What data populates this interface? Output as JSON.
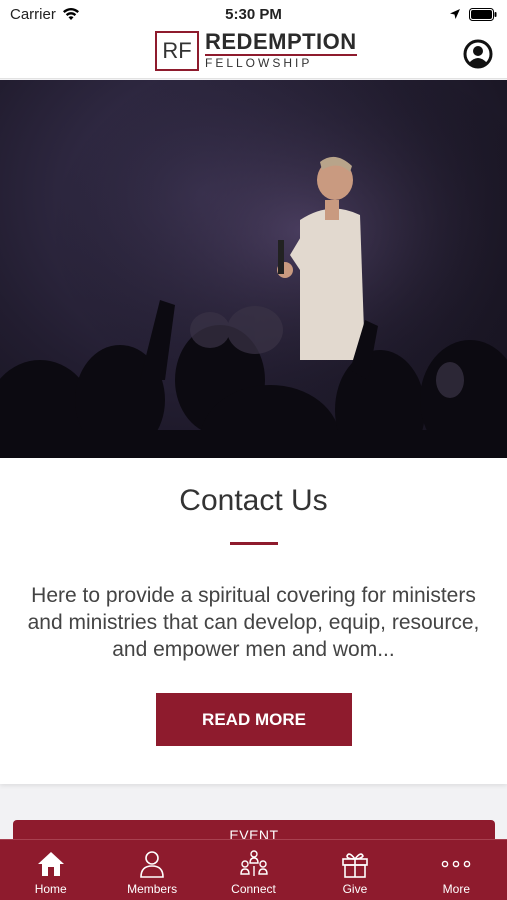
{
  "status_bar": {
    "carrier": "Carrier",
    "time": "5:30 PM"
  },
  "header": {
    "logo_initials": "RF",
    "logo_title": "REDEMPTION",
    "logo_subtitle": "FELLOWSHIP"
  },
  "card": {
    "title": "Contact Us",
    "body": "Here to provide a spiritual covering for ministers and ministries that can develop, equip, resource, and empower men and wom...",
    "button_label": "READ MORE"
  },
  "event_bar": {
    "label": "EVENT"
  },
  "tabs": [
    {
      "label": "Home",
      "icon": "home-icon"
    },
    {
      "label": "Members",
      "icon": "person-icon"
    },
    {
      "label": "Connect",
      "icon": "group-icon"
    },
    {
      "label": "Give",
      "icon": "gift-icon"
    },
    {
      "label": "More",
      "icon": "more-dots-icon"
    }
  ],
  "colors": {
    "brand": "#8e1b2d",
    "background": "#f2f2f4"
  }
}
